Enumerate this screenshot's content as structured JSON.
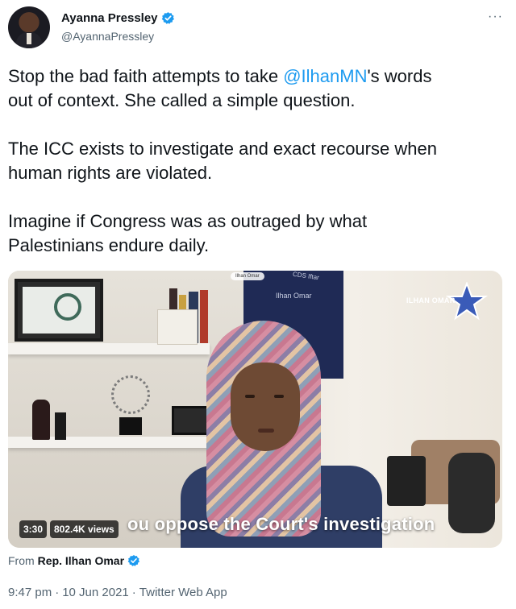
{
  "author": {
    "name": "Ayanna Pressley",
    "handle": "@AyannaPressley"
  },
  "tweet": {
    "lines": [
      {
        "before": "Stop the bad faith attempts to take ",
        "mention": "@IlhanMN",
        "after": "'s words"
      },
      {
        "text": "out of context. She called a simple question."
      },
      {
        "text": "The ICC exists to investigate and exact recourse when"
      },
      {
        "text": "human rights are violated."
      },
      {
        "text": "Imagine if Congress was as outraged by what"
      },
      {
        "text": "Palestinians endure daily."
      }
    ]
  },
  "video": {
    "duration": "3:30",
    "views": "802.4K views",
    "caption": "ou oppose the Court's investigation",
    "logo_text": "ILHAN OMAR",
    "poster_label": "Ilhan Omar",
    "chip_label": "Ilhan Omar",
    "top_tag": "CDS Iftar"
  },
  "source_account": {
    "prefix": "From",
    "name": "Rep. Ilhan Omar"
  },
  "meta": {
    "time": "9:47 pm",
    "date": "10 Jun 2021",
    "client": "Twitter Web App"
  },
  "icons": {
    "more": "more-icon",
    "verified": "verified-badge-icon"
  },
  "colors": {
    "accent": "#1d9bf0",
    "text": "#0f1419",
    "secondary": "#536471"
  }
}
